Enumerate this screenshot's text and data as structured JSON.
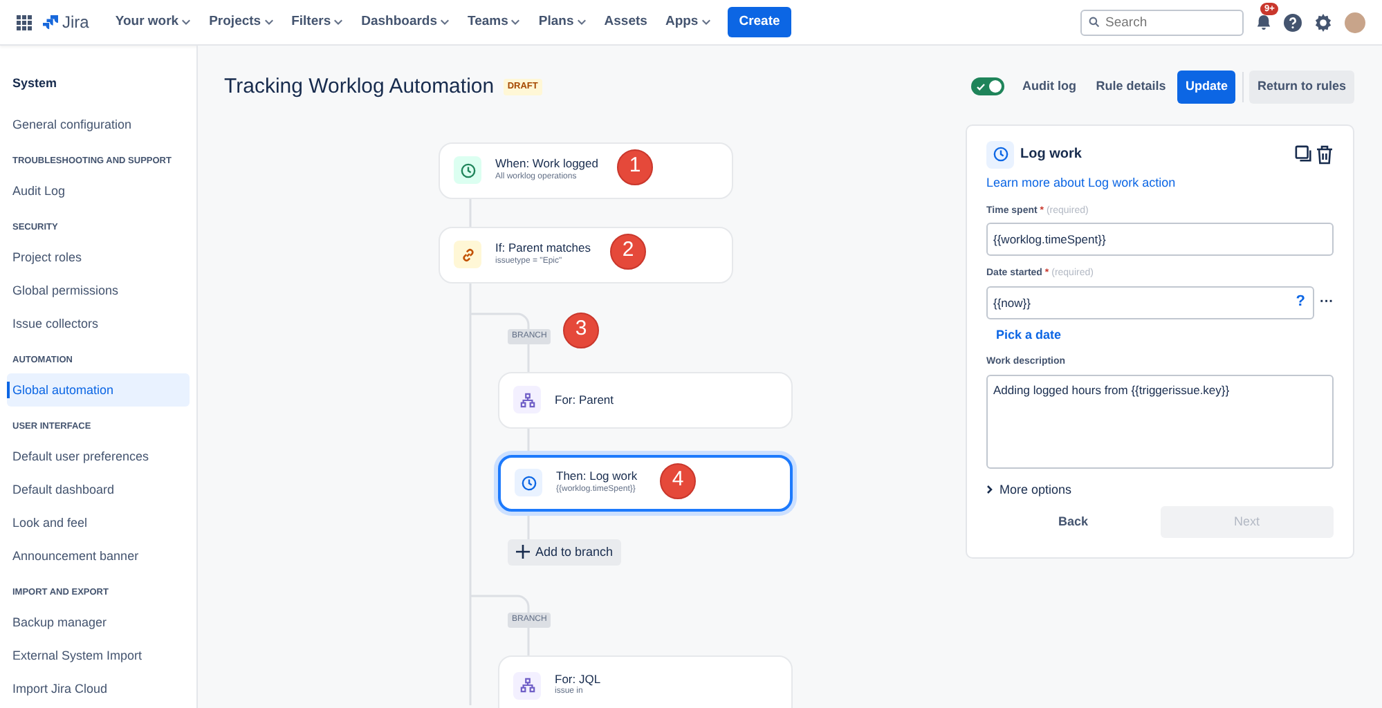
{
  "topnav": {
    "product": "Jira",
    "items": [
      {
        "label": "Your work",
        "dropdown": true
      },
      {
        "label": "Projects",
        "dropdown": true
      },
      {
        "label": "Filters",
        "dropdown": true
      },
      {
        "label": "Dashboards",
        "dropdown": true
      },
      {
        "label": "Teams",
        "dropdown": true
      },
      {
        "label": "Plans",
        "dropdown": true
      },
      {
        "label": "Assets",
        "dropdown": false
      },
      {
        "label": "Apps",
        "dropdown": true
      }
    ],
    "create": "Create",
    "search": {
      "placeholder": "Search"
    },
    "notifications": "9+"
  },
  "sidebar": {
    "title": "System",
    "sections": [
      {
        "items": [
          {
            "label": "General configuration",
            "selected": false
          }
        ]
      },
      {
        "heading": "TROUBLESHOOTING AND SUPPORT",
        "items": [
          {
            "label": "Audit Log",
            "selected": false
          }
        ]
      },
      {
        "heading": "SECURITY",
        "items": [
          {
            "label": "Project roles",
            "selected": false
          },
          {
            "label": "Global permissions",
            "selected": false
          },
          {
            "label": "Issue collectors",
            "selected": false
          }
        ]
      },
      {
        "heading": "AUTOMATION",
        "items": [
          {
            "label": "Global automation",
            "selected": true
          }
        ]
      },
      {
        "heading": "USER INTERFACE",
        "items": [
          {
            "label": "Default user preferences",
            "selected": false
          },
          {
            "label": "Default dashboard",
            "selected": false
          },
          {
            "label": "Look and feel",
            "selected": false
          },
          {
            "label": "Announcement banner",
            "selected": false
          }
        ]
      },
      {
        "heading": "IMPORT AND EXPORT",
        "items": [
          {
            "label": "Backup manager",
            "selected": false
          },
          {
            "label": "External System Import",
            "selected": false
          },
          {
            "label": "Import Jira Cloud",
            "selected": false
          }
        ]
      }
    ]
  },
  "rule": {
    "title": "Tracking Worklog Automation",
    "status": "DRAFT",
    "enabled": true,
    "actions": [
      "Audit log",
      "Rule details"
    ],
    "update": "Update",
    "return": "Return to rules"
  },
  "flow": [
    {
      "kind": "trigger",
      "title": "When: Work logged",
      "subtitle": "All worklog operations",
      "selected": false,
      "marker": "1"
    },
    {
      "kind": "condition",
      "title": "If: Parent matches",
      "subtitle": "issuetype = \"Epic\"",
      "selected": false,
      "marker": "2"
    },
    {
      "kind": "branch",
      "label": "BRANCH",
      "marker": "3"
    },
    {
      "kind": "for",
      "title": "For: Parent",
      "selected": false
    },
    {
      "kind": "action",
      "title": "Then: Log work",
      "subtitle": "{{worklog.timeSpent}}",
      "selected": true,
      "marker": "4"
    },
    {
      "kind": "add",
      "label": "Add to branch"
    },
    {
      "kind": "branch",
      "label": "BRANCH"
    },
    {
      "kind": "for",
      "title": "For: JQL",
      "subtitle": "issue in",
      "selected": false
    }
  ],
  "panel": {
    "title": "Log work",
    "link": "Learn more about Log work action",
    "fields": [
      {
        "kind": "input",
        "label": "Time spent",
        "required_mark": "*",
        "required": "(required)",
        "value": "{{worklog.timeSpent}}"
      },
      {
        "kind": "date",
        "label": "Date started",
        "required_mark": "*",
        "required": "(required)",
        "value": "{{now}}",
        "help": "?",
        "more": "···",
        "pick": "Pick a date"
      },
      {
        "kind": "textarea",
        "label": "Work description",
        "value": "Adding logged hours from {{triggerissue.key}}"
      }
    ],
    "more_options": "More options",
    "back": "Back",
    "next": "Next",
    "next_disabled": true
  }
}
